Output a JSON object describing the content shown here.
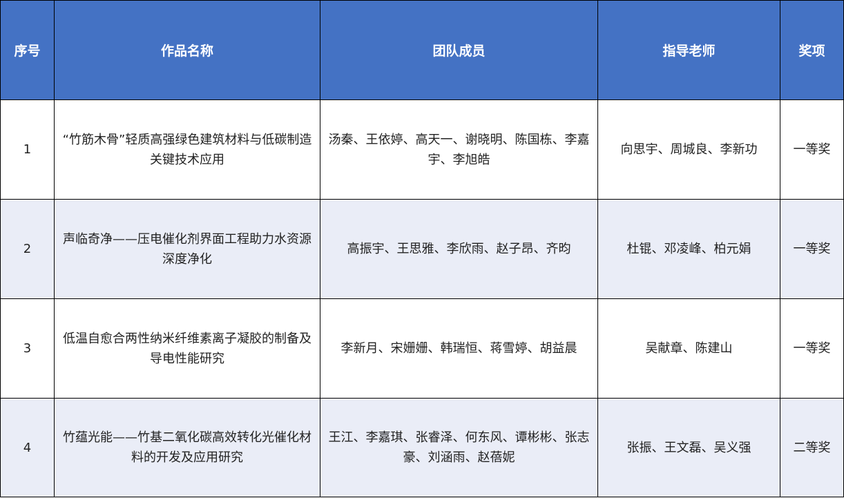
{
  "table": {
    "headers": {
      "no": "序号",
      "title": "作品名称",
      "members": "团队成员",
      "advisors": "指导老师",
      "award": "奖项"
    },
    "rows": [
      {
        "no": "1",
        "title": "“竹筋木骨”轻质高强绿色建筑材料与低碳制造关键技术应用",
        "members": "汤秦、王依婷、高天一、谢晓明、陈国栋、李嘉宇、李旭皓",
        "advisors": "向思宇、周城良、李新功",
        "award": "一等奖"
      },
      {
        "no": "2",
        "title": "声临奇净——压电催化剂界面工程助力水资源深度净化",
        "members": "高振宇、王思雅、李欣雨、赵子昂、齐昀",
        "advisors": "杜锟、邓凌峰、柏元娟",
        "award": "一等奖"
      },
      {
        "no": "3",
        "title": "低温自愈合两性纳米纤维素离子凝胶的制备及导电性能研究",
        "members": "李新月、宋姗姗、韩瑞恒、蒋雪婷、胡益晨",
        "advisors": "吴献章、陈建山",
        "award": "一等奖"
      },
      {
        "no": "4",
        "title": "竹蕴光能——竹基二氧化碳高效转化光催化材料的开发及应用研究",
        "members": "王江、李嘉琪、张睿泽、何东风、谭彬彬、张志豪、刘涵雨、赵蓓妮",
        "advisors": "张振、王文磊、吴义强",
        "award": "二等奖"
      }
    ]
  },
  "colors": {
    "header_bg": "#4472c4",
    "header_text": "#ffffff",
    "row_alt_bg": "#eaedf7",
    "border": "#000000"
  }
}
